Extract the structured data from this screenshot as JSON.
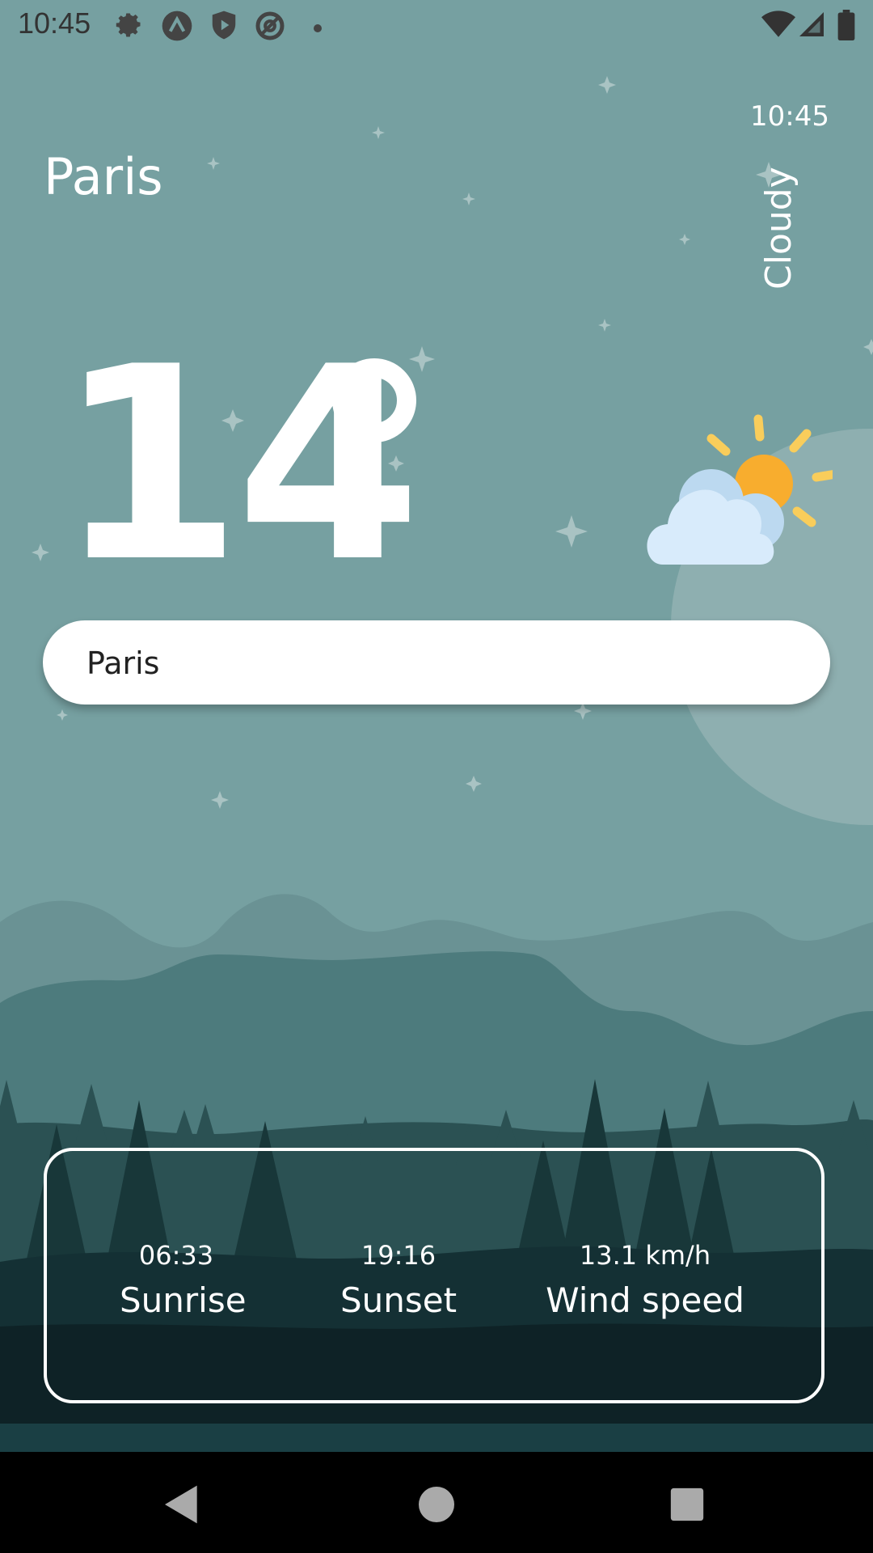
{
  "status_bar": {
    "time": "10:45",
    "icons": [
      "settings-icon",
      "app-icon-a",
      "shield-play-icon",
      "at-icon",
      "dot-icon",
      "wifi-icon",
      "signal-icon",
      "battery-icon"
    ]
  },
  "header": {
    "city": "Paris",
    "clock": "10:45",
    "condition": "Cloudy"
  },
  "temperature": {
    "value": "14",
    "unit_icon": "degree-circle"
  },
  "weather_icon": "partly-cloudy-icon",
  "search": {
    "value": "Paris",
    "placeholder": ""
  },
  "info": [
    {
      "value": "06:33",
      "label": "Sunrise"
    },
    {
      "value": "19:16",
      "label": "Sunset"
    },
    {
      "value": "13.1 km/h",
      "label": "Wind speed"
    }
  ],
  "nav": [
    "back-icon",
    "home-icon",
    "recents-icon"
  ],
  "colors": {
    "sky": "#76a0a1",
    "hill_far": "#6a9294",
    "hill_mid": "#4d7b7d",
    "forest": "#183739",
    "ground": "#102428",
    "sun": "#f8ad2e",
    "cloud": "#d8ebfb"
  }
}
